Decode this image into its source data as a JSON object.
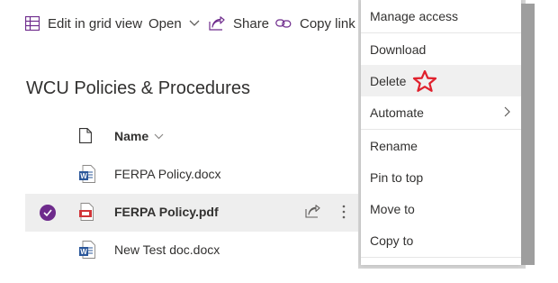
{
  "toolbar": {
    "edit_grid_label": "Edit in grid view",
    "open_label": "Open",
    "share_label": "Share",
    "copy_link_label": "Copy link"
  },
  "library": {
    "title": "WCU Policies & Procedures",
    "name_column": "Name",
    "files": [
      {
        "name": "FERPA Policy.docx",
        "type": "word",
        "selected": false
      },
      {
        "name": "FERPA Policy.pdf",
        "type": "pdf",
        "selected": true
      },
      {
        "name": "New Test doc.docx",
        "type": "word",
        "selected": false
      }
    ]
  },
  "context_menu": {
    "items": [
      {
        "label": "Manage access"
      },
      {
        "label": "Download"
      },
      {
        "label": "Delete",
        "highlighted": true,
        "annotation": "star-icon"
      },
      {
        "label": "Automate",
        "has_submenu": true
      },
      {
        "label": "Rename"
      },
      {
        "label": "Pin to top"
      },
      {
        "label": "Move to"
      },
      {
        "label": "Copy to"
      }
    ]
  },
  "colors": {
    "accent_purple": "#6e2b8c",
    "selected_row": "#eeeeee",
    "star_red": "#e0202c",
    "word_blue": "#2b579a",
    "pdf_red": "#d13438"
  }
}
